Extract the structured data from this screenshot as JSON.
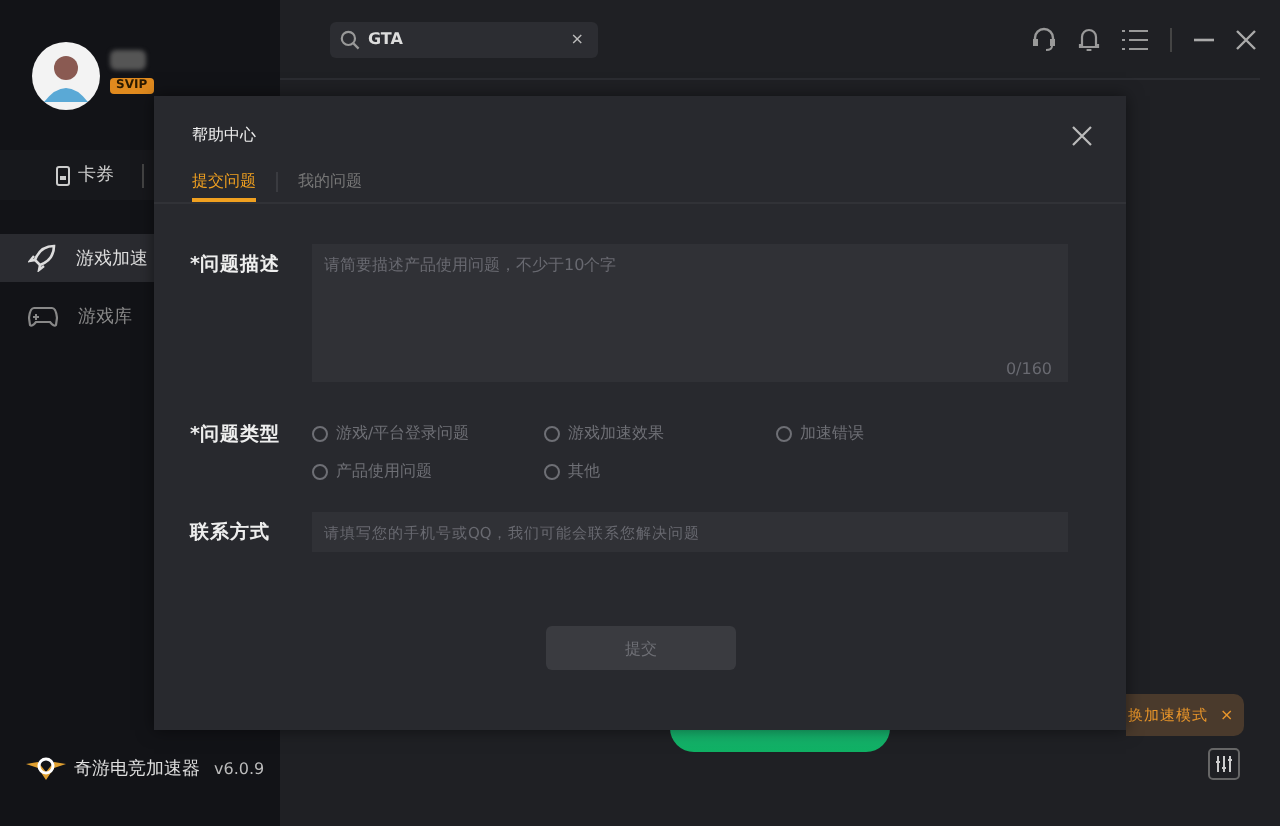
{
  "sidebar": {
    "badge": "SVIP",
    "quick_items": [
      {
        "label": "卡券"
      }
    ],
    "items": [
      {
        "label": "游戏加速",
        "selected": true,
        "kind": "rocket"
      },
      {
        "label": "游戏库",
        "selected": false,
        "kind": "gamepad"
      }
    ],
    "brand": "奇游电竞加速器",
    "version": "v6.0.9"
  },
  "search": {
    "value": "GTA",
    "clear": "×"
  },
  "tooltip": {
    "text": "换加速模式",
    "close": "×"
  },
  "dialog": {
    "title": "帮助中心",
    "tabs": [
      {
        "label": "提交问题",
        "selected": true
      },
      {
        "label": "我的问题",
        "selected": false
      }
    ],
    "description": {
      "label": "*问题描述",
      "placeholder": "请简要描述产品使用问题，不少于10个字",
      "counter": "0/160"
    },
    "type": {
      "label": "*问题类型",
      "options": [
        {
          "label": "游戏/平台登录问题",
          "selected": false
        },
        {
          "label": "游戏加速效果",
          "selected": false
        },
        {
          "label": "加速错误",
          "selected": false
        },
        {
          "label": "产品使用问题",
          "selected": false
        },
        {
          "label": "其他",
          "selected": false
        }
      ]
    },
    "contact": {
      "label": "联系方式",
      "placeholder": "请填写您的手机号或QQ，我们可能会联系您解决问题"
    },
    "submit": "提交"
  }
}
